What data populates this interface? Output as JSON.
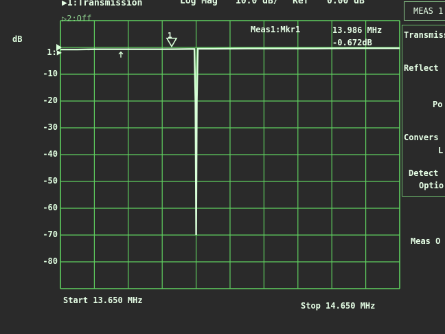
{
  "header": {
    "trace1": "▶1:Transmission",
    "trace2": "▷2:Off",
    "format": "Log Mag",
    "scale": "10.0 dB/",
    "ref_label": "Ref",
    "ref_value": "0.00 dB"
  },
  "axis": {
    "unit": "dB",
    "ref_label": "1:▶",
    "ticks": [
      "-10",
      "-20",
      "-30",
      "-40",
      "-50",
      "-60",
      "-70",
      "-80"
    ]
  },
  "marker": {
    "title": "Meas1:Mkr1",
    "frequency": "13.986 MHz",
    "value": "-0.672dB",
    "number": "1"
  },
  "footer": {
    "start": "Start 13.650 MHz",
    "stop": "Stop 14.650 MHz"
  },
  "softkeys": {
    "menu_title": "MEAS 1",
    "items": [
      "Transmiss",
      "Reflect",
      "Po",
      "Convers",
      "L",
      "Detect",
      "Optio",
      "Meas O"
    ]
  },
  "colors": {
    "trace": "#d8ffd8",
    "grid": "#5fcf5f",
    "background": "#2a2a2a"
  },
  "chart_data": {
    "type": "line",
    "x_unit": "MHz",
    "y_unit": "dB",
    "xlim": [
      13.65,
      14.65
    ],
    "ylim": [
      -90,
      10
    ],
    "series": [
      {
        "name": "Transmission",
        "x": [
          13.65,
          13.7,
          13.75,
          13.8,
          13.85,
          13.9,
          13.95,
          13.986,
          14.03,
          14.045,
          14.048,
          14.05,
          14.052,
          14.055,
          14.07,
          14.1,
          14.2,
          14.3,
          14.4,
          14.5,
          14.6,
          14.65
        ],
        "y": [
          -0.8,
          -0.8,
          -0.7,
          -0.7,
          -0.7,
          -0.7,
          -0.7,
          -0.672,
          -0.6,
          -0.6,
          -20,
          -70,
          -20,
          -0.5,
          -0.5,
          -0.5,
          -0.4,
          -0.4,
          -0.4,
          -0.3,
          -0.3,
          -0.3
        ]
      }
    ]
  }
}
